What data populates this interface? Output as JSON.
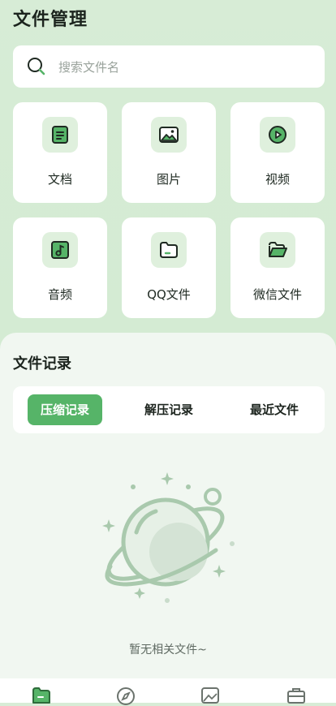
{
  "page_title": "文件管理",
  "search": {
    "placeholder": "搜索文件名"
  },
  "categories": [
    {
      "label": "文档",
      "icon": "document-icon"
    },
    {
      "label": "图片",
      "icon": "image-icon"
    },
    {
      "label": "视频",
      "icon": "video-play-icon"
    },
    {
      "label": "音频",
      "icon": "audio-note-icon"
    },
    {
      "label": "QQ文件",
      "icon": "folder-icon"
    },
    {
      "label": "微信文件",
      "icon": "open-folder-icon"
    }
  ],
  "records": {
    "title": "文件记录",
    "tabs": [
      {
        "label": "压缩记录",
        "active": true
      },
      {
        "label": "解压记录",
        "active": false
      },
      {
        "label": "最近文件",
        "active": false
      }
    ],
    "empty_text": "暂无相关文件~"
  },
  "bottom_nav": [
    {
      "icon": "files-icon",
      "active": true
    },
    {
      "icon": "compass-icon",
      "active": false
    },
    {
      "icon": "gallery-icon",
      "active": false
    },
    {
      "icon": "toolbox-icon",
      "active": false
    }
  ],
  "colors": {
    "accent": "#56b468",
    "icon_dark": "#1f2a22",
    "icon_bg": "#dff0dd"
  }
}
